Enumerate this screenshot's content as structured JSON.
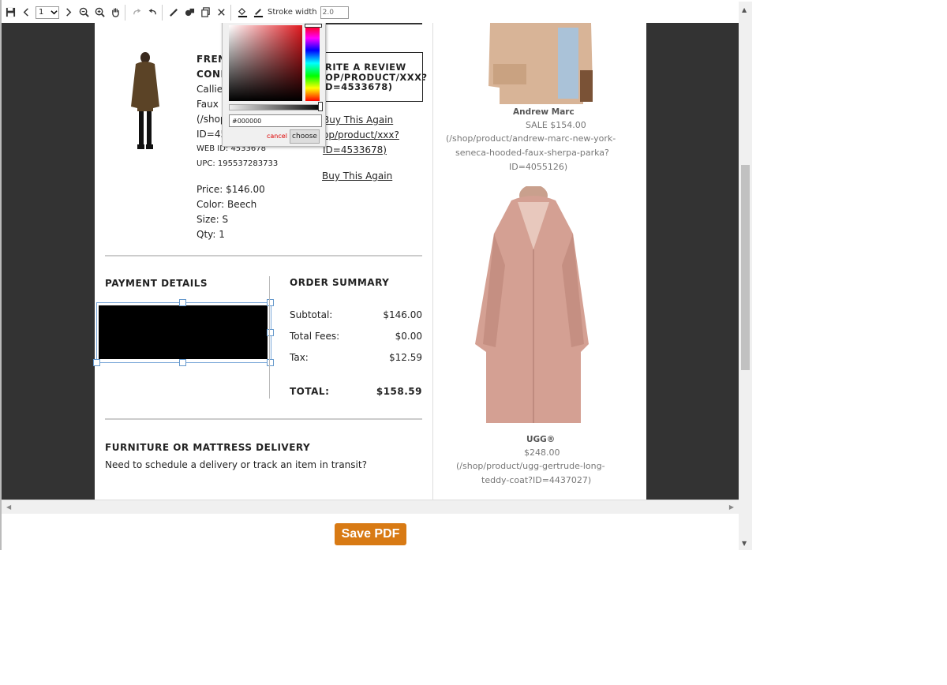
{
  "toolbar": {
    "page_number": "1",
    "stroke_label": "Stroke width",
    "stroke_value": "2.0"
  },
  "color_picker": {
    "hex": "#000000",
    "cancel": "cancel",
    "choose": "choose"
  },
  "order_item": {
    "title_line1": "FREN",
    "title_line2": "CONI",
    "line1": "Callie",
    "line2": "Faux",
    "line3": "(/shop",
    "line4": "ID=45",
    "web_id": "WEB ID: 4533678",
    "upc": "UPC: 195537283733",
    "price": "Price: $146.00",
    "color": "Color: Beech",
    "size": "Size: S",
    "qty": "Qty: 1"
  },
  "review": {
    "line1": "RITE A REVIEW",
    "line2": "OP/PRODUCT/XXX?",
    "line3": "D=4533678)",
    "buy_again_1": "Buy This Again",
    "link_line1": "op/product/xxx?",
    "link_line2": "ID=4533678)",
    "buy_again_2": "Buy This Again"
  },
  "payment": {
    "heading": "PAYMENT DETAILS"
  },
  "summary": {
    "heading": "ORDER SUMMARY",
    "subtotal_label": "Subtotal:",
    "subtotal": "$146.00",
    "fees_label": "Total Fees:",
    "fees": "$0.00",
    "tax_label": "Tax:",
    "tax": "$12.59",
    "total_label": "TOTAL:",
    "total": "$158.59"
  },
  "delivery": {
    "heading": "FURNITURE OR MATTRESS DELIVERY",
    "text": "Need to schedule a delivery or track an item in transit?"
  },
  "recs": [
    {
      "brand": "Andrew Marc",
      "price": "SALE $154.00",
      "line1": "(/shop/product/andrew-marc-new-york-",
      "line2": "seneca-hooded-faux-sherpa-parka?",
      "line3": "ID=4055126)"
    },
    {
      "brand": "UGG®",
      "price": "$248.00",
      "line1": "(/shop/product/ugg-gertrude-long-",
      "line2": "teddy-coat?ID=4437027)"
    }
  ],
  "save_button": "Save PDF",
  "colors": {
    "save_button": "#d87a14",
    "viewer_bg": "#333333",
    "redaction": "#000000"
  }
}
